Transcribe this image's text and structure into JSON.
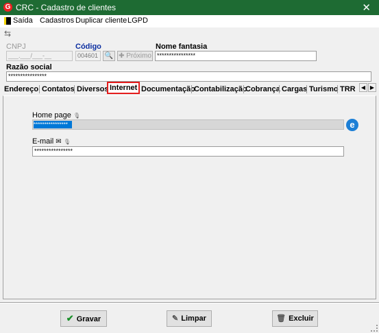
{
  "window": {
    "title": "CRC - Cadastro de clientes",
    "close_glyph": "✕",
    "app_icon_letter": "G"
  },
  "menu": {
    "items": [
      "Saída",
      "Cadastros",
      "Duplicar cliente",
      "LGPD"
    ]
  },
  "form": {
    "cnpj_label": "CNPJ",
    "cnpj_value": "___.___/___-__",
    "codigo_label": "Código",
    "codigo_value": "004601",
    "proximo_label": "Próximo",
    "nome_fantasia_label": "Nome fantasia",
    "nome_fantasia_value": "****************",
    "razao_social_label": "Razão social",
    "razao_social_value": "****************"
  },
  "tabs": [
    "Endereço",
    "Contatos",
    "Diversos",
    "Internet",
    "Documentação",
    "Contabilização",
    "Cobrança",
    "Cargas",
    "Turismo",
    "TRR"
  ],
  "active_tab": "Internet",
  "internet": {
    "home_page_label": "Home page",
    "home_page_value": "****************",
    "email_label": "E-mail",
    "email_value": "****************"
  },
  "buttons": {
    "gravar": "Gravar",
    "limpar": "Limpar",
    "excluir": "Excluir"
  },
  "colors": {
    "titlebar": "#1e6b33",
    "active_tab_border": "#e41c1c",
    "selection": "#0078d7"
  }
}
